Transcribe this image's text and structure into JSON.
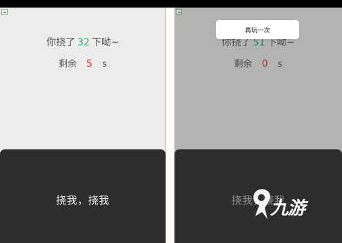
{
  "left_screen": {
    "score": {
      "prefix": "你挠了",
      "count": "32",
      "suffix": "下呦~"
    },
    "remaining": {
      "prefix": "剩余",
      "seconds": "5",
      "unit": "s"
    },
    "tap_button_label": "挠我，挠我"
  },
  "right_screen": {
    "replay_button_label": "再玩一次",
    "score": {
      "prefix": "你挠了",
      "count": "51",
      "suffix": "下呦~"
    },
    "remaining": {
      "prefix": "剩余",
      "seconds": "0",
      "unit": "s"
    },
    "tap_button_label": "挠我，挠我"
  },
  "watermark": {
    "logo_icon": "9game-logo-icon",
    "text": "九游"
  },
  "colors": {
    "score_number": "#2ea66e",
    "seconds_number": "#d9342b",
    "tap_area": "#2e2e2e",
    "overlay": "#b3b3b3"
  }
}
